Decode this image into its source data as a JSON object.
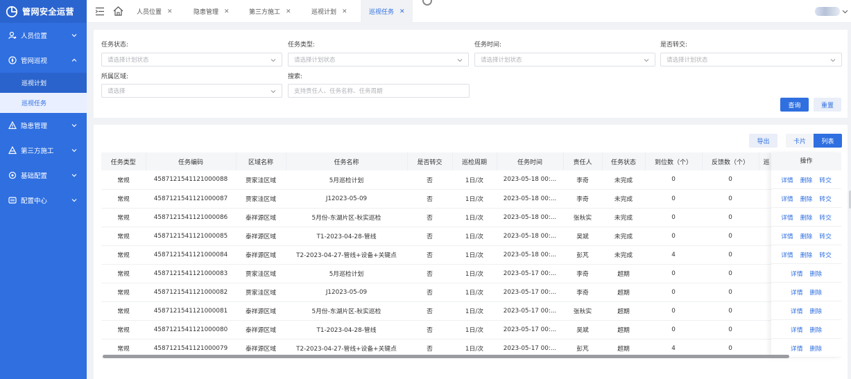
{
  "app": {
    "title": "管网安全运营"
  },
  "sidebar": {
    "items": [
      {
        "label": "人员位置",
        "icon": "person-location-icon"
      },
      {
        "label": "管网巡视",
        "icon": "patrol-icon",
        "children": [
          {
            "label": "巡视计划"
          },
          {
            "label": "巡视任务"
          }
        ]
      },
      {
        "label": "隐患管理",
        "icon": "warning-icon"
      },
      {
        "label": "第三方施工",
        "icon": "construction-icon"
      },
      {
        "label": "基础配置",
        "icon": "settings-icon"
      },
      {
        "label": "配置中心",
        "icon": "config-center-icon"
      }
    ]
  },
  "tabs": [
    {
      "label": "人员位置"
    },
    {
      "label": "隐患管理"
    },
    {
      "label": "第三方施工"
    },
    {
      "label": "巡视计划"
    },
    {
      "label": "巡视任务"
    }
  ],
  "filters": {
    "status": {
      "label": "任务状态:",
      "placeholder": "请选择计划状态"
    },
    "type": {
      "label": "任务类型:",
      "placeholder": "请选择计划状态"
    },
    "time": {
      "label": "任务时间:",
      "placeholder": "请选择计划状态"
    },
    "transfer": {
      "label": "是否转交:",
      "placeholder": "请选择计划状态"
    },
    "area": {
      "label": "所属区域:",
      "placeholder": "请选择"
    },
    "search": {
      "label": "搜索:",
      "placeholder": "支持责任人、任务名称、任务周期"
    },
    "query_button": "查询",
    "reset_button": "重置"
  },
  "toolbar": {
    "export": "导出",
    "card": "卡片",
    "list": "列表"
  },
  "table": {
    "headers": [
      "任务类型",
      "任务编码",
      "区域名称",
      "任务名称",
      "是否转交",
      "巡检周期",
      "任务时间",
      "责任人",
      "任务状态",
      "到位数（个）",
      "反馈数（个）",
      "巡"
    ],
    "ops_header": "操作",
    "ops": {
      "detail": "详情",
      "delete": "删除",
      "transfer": "转交"
    },
    "rows": [
      [
        "常规",
        "4587121541121000088",
        "贾家洼区域",
        "5月巡检计划",
        "否",
        "1日/次",
        "2023-05-18 00:...",
        "李奇",
        "未完成",
        "0",
        "0",
        ""
      ],
      [
        "常规",
        "4587121541121000087",
        "贾家洼区域",
        "J12023-05-09",
        "否",
        "1日/次",
        "2023-05-18 00:...",
        "李奇",
        "未完成",
        "0",
        "0",
        ""
      ],
      [
        "常规",
        "4587121541121000086",
        "泰祥源区域",
        "5月份-东湖片区-秋实巡检",
        "否",
        "1日/次",
        "2023-05-18 00:...",
        "张秋实",
        "未完成",
        "0",
        "0",
        ""
      ],
      [
        "常规",
        "4587121541121000085",
        "泰祥源区域",
        "T1-2023-04-28-管线",
        "否",
        "1日/次",
        "2023-05-18 00:...",
        "吴斌",
        "未完成",
        "0",
        "0",
        ""
      ],
      [
        "常规",
        "4587121541121000084",
        "泰祥源区域",
        "T2-2023-04-27-管线+设备+关键点",
        "否",
        "1日/次",
        "2023-05-18 00:...",
        "彭芃",
        "未完成",
        "4",
        "0",
        ""
      ],
      [
        "常规",
        "4587121541121000083",
        "贾家洼区域",
        "5月巡检计划",
        "否",
        "1日/次",
        "2023-05-17 00:...",
        "李奇",
        "超期",
        "0",
        "0",
        ""
      ],
      [
        "常规",
        "4587121541121000082",
        "贾家洼区域",
        "J12023-05-09",
        "否",
        "1日/次",
        "2023-05-17 00:...",
        "李奇",
        "超期",
        "0",
        "0",
        ""
      ],
      [
        "常规",
        "4587121541121000081",
        "泰祥源区域",
        "5月份-东湖片区-秋实巡检",
        "否",
        "1日/次",
        "2023-05-17 00:...",
        "张秋实",
        "超期",
        "0",
        "0",
        ""
      ],
      [
        "常规",
        "4587121541121000080",
        "泰祥源区域",
        "T1-2023-04-28-管线",
        "否",
        "1日/次",
        "2023-05-17 00:...",
        "吴斌",
        "超期",
        "0",
        "0",
        ""
      ],
      [
        "常规",
        "4587121541121000079",
        "泰祥源区域",
        "T2-2023-04-27-管线+设备+关键点",
        "否",
        "1日/次",
        "2023-05-17 00:...",
        "彭芃",
        "超期",
        "4",
        "0",
        ""
      ]
    ],
    "row_ops": [
      [
        "detail",
        "delete",
        "transfer"
      ],
      [
        "detail",
        "delete",
        "transfer"
      ],
      [
        "detail",
        "delete",
        "transfer"
      ],
      [
        "detail",
        "delete",
        "transfer"
      ],
      [
        "detail",
        "delete",
        "transfer"
      ],
      [
        "detail",
        "delete"
      ],
      [
        "detail",
        "delete"
      ],
      [
        "detail",
        "delete"
      ],
      [
        "detail",
        "delete"
      ],
      [
        "detail",
        "delete"
      ]
    ]
  },
  "colors": {
    "primary": "#2f6fe0",
    "sidebar": "#2f6fe0"
  }
}
